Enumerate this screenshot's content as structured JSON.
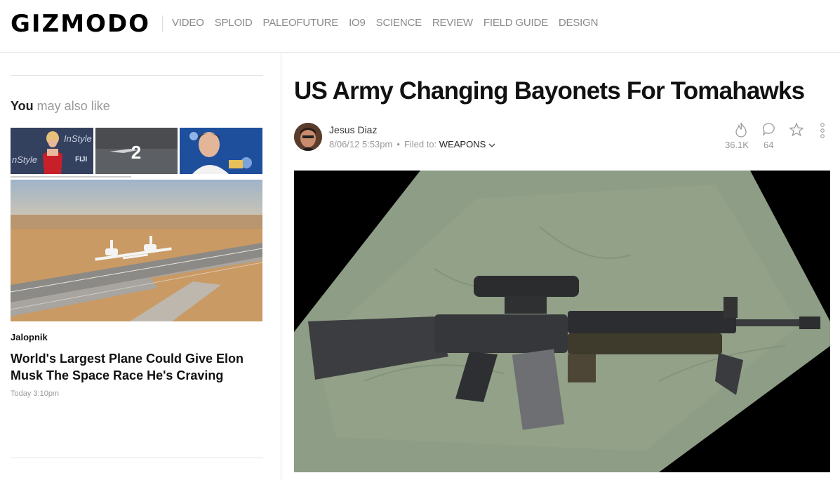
{
  "site": {
    "logo": "GIZMODO",
    "nav": [
      "VIDEO",
      "SPLOID",
      "PALEOFUTURE",
      "IO9",
      "SCIENCE",
      "REVIEW",
      "FIELD GUIDE",
      "DESIGN"
    ]
  },
  "sidebar": {
    "heading_strong": "You",
    "heading_rest": " may also like",
    "thumbs": [
      {
        "label": "InStyle"
      },
      {
        "label": "2"
      },
      {
        "label": ""
      }
    ],
    "card": {
      "source": "Jalopnik",
      "title": "World's Largest Plane Could Give Elon Musk The Space Race He's Craving",
      "time": "Today 3:10pm"
    }
  },
  "article": {
    "title": "US Army Changing Bayonets For Tomahawks",
    "author": "Jesus Diaz",
    "date": "8/06/12 5:53pm",
    "filed_label": "Filed to:",
    "filed_tag": "WEAPONS",
    "views": "36.1K",
    "comments": "64"
  },
  "colors": {
    "accent_text": "#111111",
    "muted_text": "#999999",
    "nav_text": "#8a8a8a",
    "cloth": "#8f9f86"
  }
}
